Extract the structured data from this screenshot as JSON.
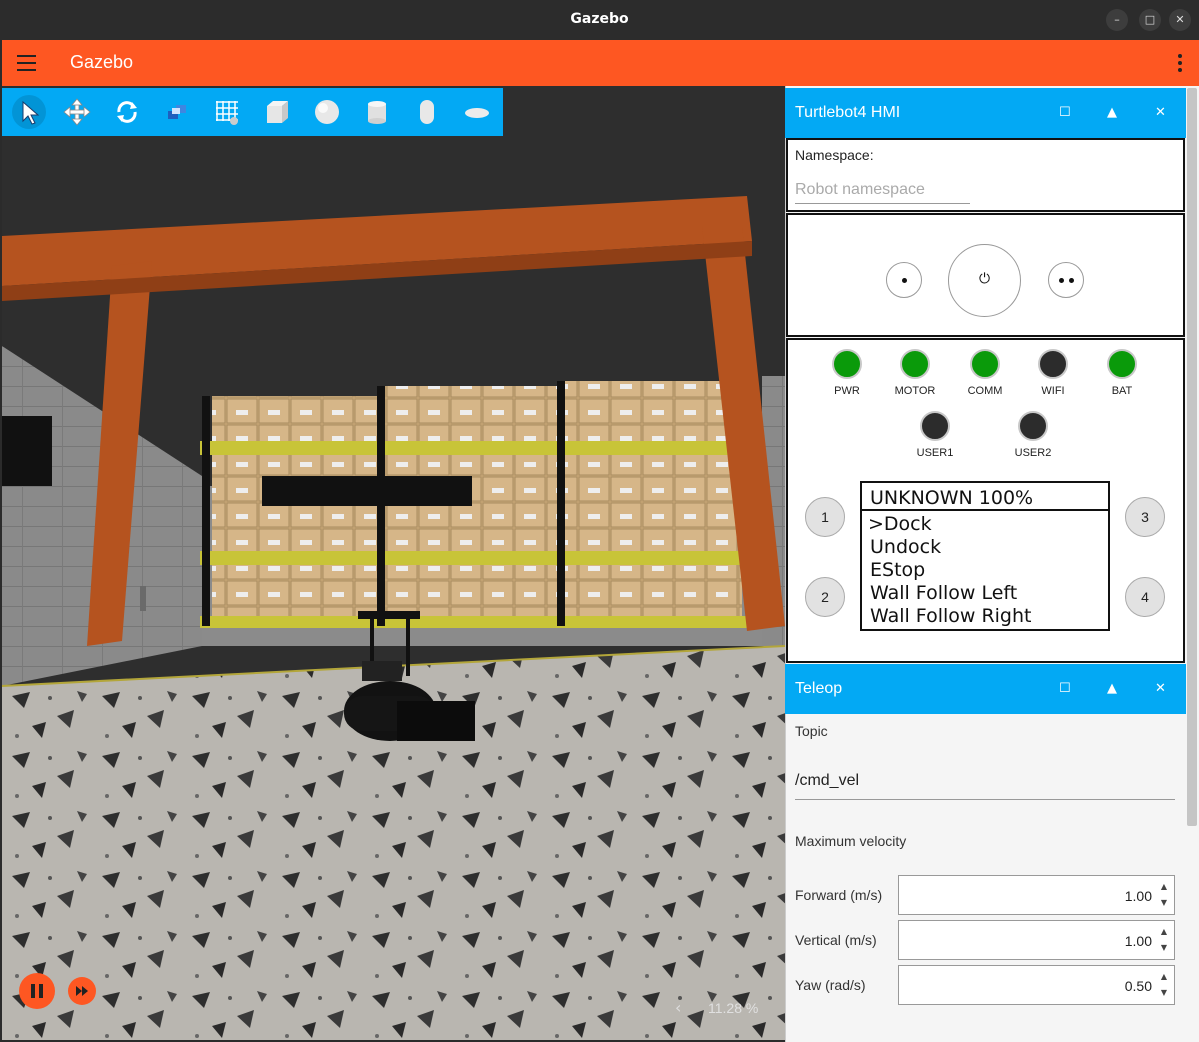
{
  "window": {
    "title": "Gazebo"
  },
  "appbar": {
    "title": "Gazebo"
  },
  "toolbar": {
    "tools": [
      "select-icon",
      "translate-icon",
      "rotate-icon",
      "transform-control-icon",
      "grid-snap-icon",
      "box-icon",
      "sphere-icon",
      "cylinder-icon",
      "capsule-icon",
      "ellipsoid-icon"
    ]
  },
  "playback": {
    "rtf_value": "11.28 %",
    "rtf_arrow": "‹"
  },
  "hmi": {
    "title": "Turtlebot4 HMI",
    "namespace_label": "Namespace:",
    "namespace_placeholder": "Robot namespace",
    "power_symbol": "⏻",
    "leds": [
      {
        "label": "PWR",
        "color": "#0a9a0a"
      },
      {
        "label": "MOTOR",
        "color": "#0a9a0a"
      },
      {
        "label": "COMM",
        "color": "#0a9a0a"
      },
      {
        "label": "WIFI",
        "color": "#2c2c2c"
      },
      {
        "label": "BAT",
        "color": "#0a9a0a"
      },
      {
        "label": "USER1",
        "color": "#2c2c2c"
      },
      {
        "label": "USER2",
        "color": "#2c2c2c"
      }
    ],
    "buttons": [
      "1",
      "2",
      "3",
      "4"
    ],
    "display": {
      "header": "UNKNOWN 100%",
      "items": [
        ">Dock",
        "Undock",
        "EStop",
        "Wall Follow Left",
        "Wall Follow Right"
      ]
    }
  },
  "teleop": {
    "title": "Teleop",
    "topic_label": "Topic",
    "topic_value": "/cmd_vel",
    "max_velocity_label": "Maximum velocity",
    "fields": [
      {
        "label": "Forward (m/s)",
        "value": "1.00"
      },
      {
        "label": "Vertical (m/s)",
        "value": "1.00"
      },
      {
        "label": "Yaw (rad/s)",
        "value": "0.50"
      }
    ]
  },
  "panel_controls": {
    "maximize": "☐",
    "collapse": "▲",
    "close": "✕"
  },
  "colors": {
    "appbar": "#fe5722",
    "accent": "#03a9f4",
    "led_on": "#0a9a0a",
    "led_off": "#2c2c2c"
  }
}
